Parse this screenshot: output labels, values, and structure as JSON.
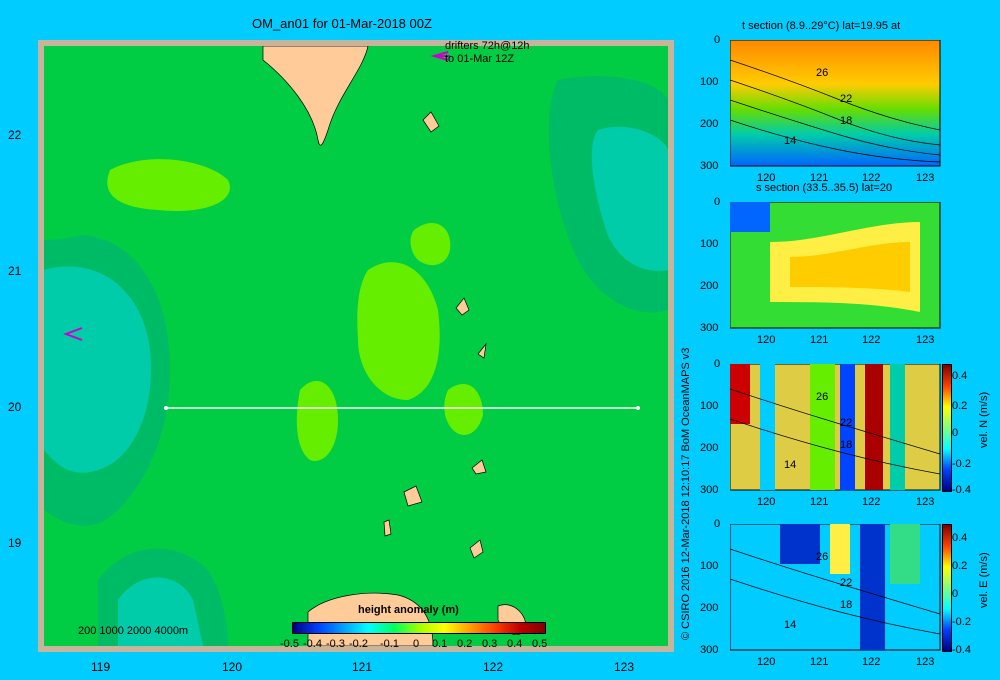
{
  "chart_data": [
    {
      "type": "heatmap",
      "title": "OM_an01 for 01-Mar-2018 00Z",
      "xlim": [
        118.5,
        123.5
      ],
      "ylim": [
        18.3,
        22.7
      ],
      "xticks": [
        "119",
        "120",
        "121",
        "122",
        "123"
      ],
      "yticks": [
        "19",
        "20",
        "21",
        "22"
      ],
      "annotation_drifters": [
        "drifters 72h@12h",
        "to 01-Mar 12Z"
      ],
      "depth_legend": "200  1000  2000  4000m",
      "section_line": {
        "lat": 20.0,
        "lon": [
          119.5,
          123.2
        ]
      },
      "colorbar": {
        "label": "height anomaly  (m)",
        "ticks": [
          "-0.5",
          "-0.4",
          "-0.3",
          "-0.2",
          "-0.1",
          "0",
          "0.1",
          "0.2",
          "0.3",
          "0.4",
          "0.5"
        ],
        "range": [
          -0.5,
          0.5
        ]
      },
      "colors": {
        "background": "#00ccff",
        "land": "#ffcc99",
        "shelf": "#c8b49a",
        "high": "#66ee00",
        "mid": "#00cc44",
        "low": "#00ccaa"
      }
    },
    {
      "type": "heatmap",
      "title": "t section (8.9..29°C) lat=19.95 at",
      "xticks": [
        "120",
        "121",
        "122",
        "123"
      ],
      "yticks": [
        "0",
        "100",
        "200",
        "300"
      ],
      "contour_labels": [
        "26",
        "22",
        "18",
        "14"
      ]
    },
    {
      "type": "heatmap",
      "title": "s section (33.5..35.5) lat=20",
      "xticks": [
        "120",
        "121",
        "122",
        "123"
      ],
      "yticks": [
        "0",
        "100",
        "200",
        "300"
      ]
    },
    {
      "type": "heatmap",
      "ylabel": "vel. N (m/s)",
      "xticks": [
        "120",
        "121",
        "122",
        "123"
      ],
      "yticks": [
        "0",
        "100",
        "200",
        "300"
      ],
      "contour_labels": [
        "26",
        "22",
        "18",
        "14"
      ],
      "colorbar_ticks": [
        "0.4",
        "0.2",
        "0",
        "-0.2",
        "-0.4"
      ]
    },
    {
      "type": "heatmap",
      "ylabel": "vel. E (m/s)",
      "xticks": [
        "120",
        "121",
        "122",
        "123"
      ],
      "yticks": [
        "0",
        "100",
        "200",
        "300"
      ],
      "contour_labels": [
        "26",
        "22",
        "18",
        "14"
      ],
      "colorbar_ticks": [
        "0.4",
        "0.2",
        "0",
        "-0.2",
        "-0.4"
      ]
    }
  ],
  "credit": "© CSIRO 2016   12-Mar-2018 12:10:17 BoM OceanMAPS v3"
}
